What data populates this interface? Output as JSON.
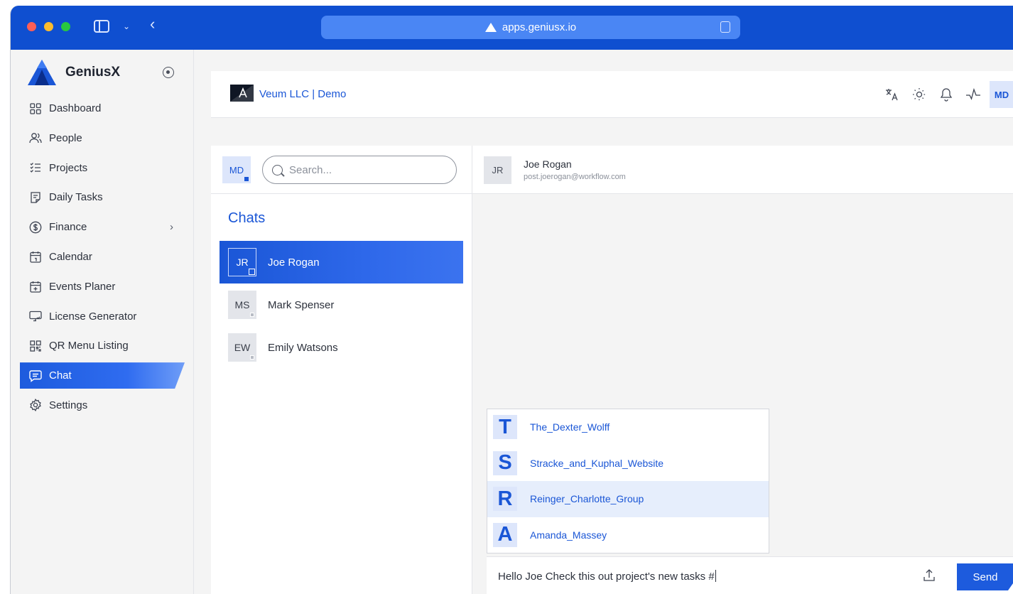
{
  "browser": {
    "url": "apps.geniusx.io"
  },
  "app": {
    "brand": "GeniusX"
  },
  "sidebar": {
    "items": [
      {
        "label": "Dashboard",
        "icon": "grid-icon"
      },
      {
        "label": "People",
        "icon": "people-icon"
      },
      {
        "label": "Projects",
        "icon": "checklist-icon"
      },
      {
        "label": "Daily Tasks",
        "icon": "task-icon"
      },
      {
        "label": "Finance",
        "icon": "dollar-icon"
      },
      {
        "label": "Calendar",
        "icon": "calendar-icon"
      },
      {
        "label": "Events Planer",
        "icon": "calendar-plus-icon"
      },
      {
        "label": "License Generator",
        "icon": "monitor-icon"
      },
      {
        "label": "QR Menu Listing",
        "icon": "qr-icon"
      },
      {
        "label": "Chat",
        "icon": "chat-icon",
        "active": true
      },
      {
        "label": "Settings",
        "icon": "gear-icon"
      }
    ]
  },
  "topbar": {
    "org_name": "Veum LLC | Demo",
    "user_initials": "MD"
  },
  "chat": {
    "me_initials": "MD",
    "search_placeholder": "Search...",
    "list_title": "Chats",
    "contacts": [
      {
        "initials": "JR",
        "name": "Joe Rogan"
      },
      {
        "initials": "MS",
        "name": "Mark Spenser"
      },
      {
        "initials": "EW",
        "name": "Emily Watsons"
      }
    ],
    "active_contact": {
      "initials": "JR",
      "name": "Joe Rogan",
      "email": "post.joerogan@workflow.com"
    },
    "mentions": [
      {
        "letter": "T",
        "name": "The_Dexter_Wolff"
      },
      {
        "letter": "S",
        "name": "Stracke_and_Kuphal_Website"
      },
      {
        "letter": "R",
        "name": "Reinger_Charlotte_Group"
      },
      {
        "letter": "A",
        "name": "Amanda_Massey"
      }
    ],
    "composer_text": "Hello Joe Check this out project's new tasks #",
    "send_label": "Send"
  },
  "colors": {
    "accent": "#1a56d6",
    "titlebar": "#0f4fd0"
  }
}
